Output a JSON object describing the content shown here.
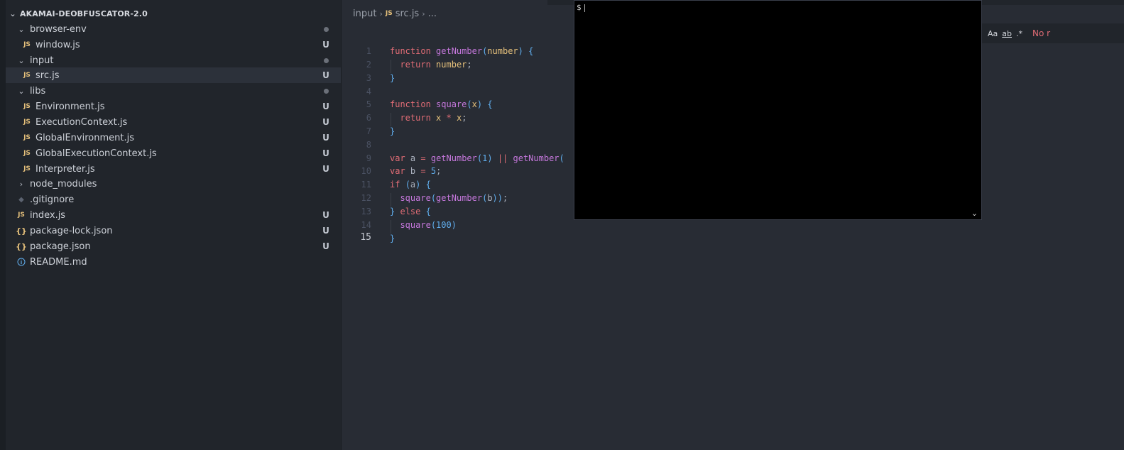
{
  "explorer": {
    "root_label": "AKAMAI-DEOBFUSCATOR-2.0",
    "items": [
      {
        "label": "browser-env",
        "kind": "folder",
        "badge": "dot"
      },
      {
        "label": "window.js",
        "kind": "js",
        "badge": "U"
      },
      {
        "label": "input",
        "kind": "folder",
        "badge": "dot"
      },
      {
        "label": "src.js",
        "kind": "js",
        "badge": "U"
      },
      {
        "label": "libs",
        "kind": "folder",
        "badge": "dot"
      },
      {
        "label": "Environment.js",
        "kind": "js",
        "badge": "U"
      },
      {
        "label": "ExecutionContext.js",
        "kind": "js",
        "badge": "U"
      },
      {
        "label": "GlobalEnvironment.js",
        "kind": "js",
        "badge": "U"
      },
      {
        "label": "GlobalExecutionContext.js",
        "kind": "js",
        "badge": "U"
      },
      {
        "label": "Interpreter.js",
        "kind": "js",
        "badge": "U"
      },
      {
        "label": "node_modules",
        "kind": "folder-collapsed",
        "badge": ""
      },
      {
        "label": ".gitignore",
        "kind": "git",
        "badge": ""
      },
      {
        "label": "index.js",
        "kind": "js",
        "badge": "U"
      },
      {
        "label": "package-lock.json",
        "kind": "json",
        "badge": "U"
      },
      {
        "label": "package.json",
        "kind": "json",
        "badge": "U"
      },
      {
        "label": "README.md",
        "kind": "info",
        "badge": ""
      }
    ],
    "icons": {
      "js": "JS",
      "json": "{}"
    }
  },
  "breadcrumb": {
    "folder": "input",
    "file": "src.js",
    "more": "..."
  },
  "editor": {
    "line_numbers": [
      "1",
      "2",
      "3",
      "4",
      "5",
      "6",
      "7",
      "8",
      "9",
      "10",
      "11",
      "12",
      "13",
      "14",
      "15"
    ],
    "active_line": "15"
  },
  "find": {
    "match_case": "Aa",
    "whole_word": "ab",
    "regex": ".*",
    "result": "No r"
  },
  "terminal": {
    "prompt": "$"
  },
  "colors": {
    "sidebar_bg": "#21252b",
    "editor_bg": "#282c34",
    "keyword": "#e06c75",
    "function": "#c678dd",
    "param": "#e5c07b",
    "number": "#61afef"
  }
}
